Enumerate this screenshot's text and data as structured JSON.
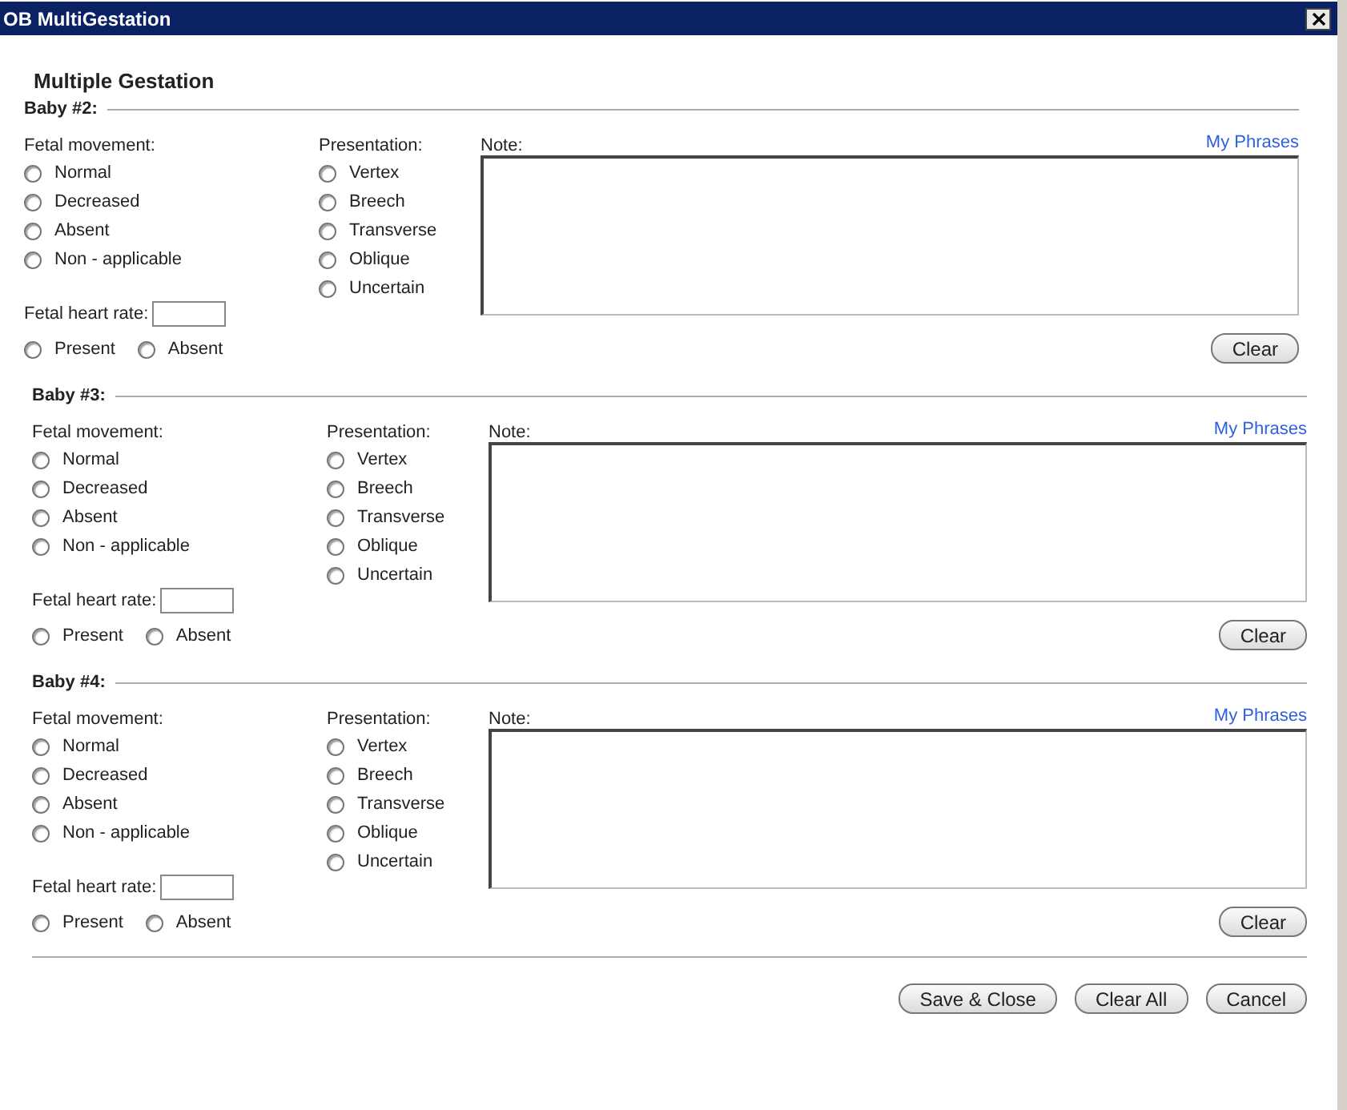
{
  "window": {
    "title": "OB MultiGestation"
  },
  "heading": "Multiple Gestation",
  "babies": [
    {
      "title": "Baby #2:",
      "movement": {
        "label": "Fetal movement:",
        "options": [
          {
            "label": "Normal",
            "selected": false
          },
          {
            "label": "Decreased",
            "selected": false
          },
          {
            "label": "Absent",
            "selected": false
          },
          {
            "label": "Non - applicable",
            "selected": false
          }
        ]
      },
      "presentation": {
        "label": "Presentation:",
        "options": [
          {
            "label": "Vertex",
            "selected": false
          },
          {
            "label": "Breech",
            "selected": false
          },
          {
            "label": "Transverse",
            "selected": false
          },
          {
            "label": "Oblique",
            "selected": false
          },
          {
            "label": "Uncertain",
            "selected": false
          }
        ]
      },
      "heart_rate": {
        "label": "Fetal heart rate:",
        "options": [
          {
            "label": "Present",
            "selected": false
          },
          {
            "label": "Absent",
            "selected": false
          }
        ]
      },
      "note": {
        "label": "Note:",
        "link": "My Phrases",
        "clear": "Clear"
      }
    },
    {
      "title": "Baby #3:",
      "movement": {
        "label": "Fetal movement:",
        "options": [
          {
            "label": "Normal",
            "selected": false
          },
          {
            "label": "Decreased",
            "selected": false
          },
          {
            "label": "Absent",
            "selected": false
          },
          {
            "label": "Non - applicable",
            "selected": false
          }
        ]
      },
      "presentation": {
        "label": "Presentation:",
        "options": [
          {
            "label": "Vertex",
            "selected": false
          },
          {
            "label": "Breech",
            "selected": false
          },
          {
            "label": "Transverse",
            "selected": false
          },
          {
            "label": "Oblique",
            "selected": false
          },
          {
            "label": "Uncertain",
            "selected": false
          }
        ]
      },
      "heart_rate": {
        "label": "Fetal heart rate:",
        "options": [
          {
            "label": "Present",
            "selected": false
          },
          {
            "label": "Absent",
            "selected": false
          }
        ]
      },
      "note": {
        "label": "Note:",
        "link": "My Phrases",
        "clear": "Clear"
      }
    },
    {
      "title": "Baby #4:",
      "movement": {
        "label": "Fetal movement:",
        "options": [
          {
            "label": "Normal",
            "selected": false
          },
          {
            "label": "Decreased",
            "selected": false
          },
          {
            "label": "Absent",
            "selected": false
          },
          {
            "label": "Non - applicable",
            "selected": false
          }
        ]
      },
      "presentation": {
        "label": "Presentation:",
        "options": [
          {
            "label": "Vertex",
            "selected": false
          },
          {
            "label": "Breech",
            "selected": false
          },
          {
            "label": "Transverse",
            "selected": false
          },
          {
            "label": "Oblique",
            "selected": false
          },
          {
            "label": "Uncertain",
            "selected": false
          }
        ]
      },
      "heart_rate": {
        "label": "Fetal heart rate:",
        "options": [
          {
            "label": "Present",
            "selected": false
          },
          {
            "label": "Absent",
            "selected": false
          }
        ]
      },
      "note": {
        "label": "Note:",
        "link": "My Phrases",
        "clear": "Clear"
      }
    }
  ],
  "buttons": [
    "Save & Close",
    "Clear All",
    "Cancel"
  ]
}
